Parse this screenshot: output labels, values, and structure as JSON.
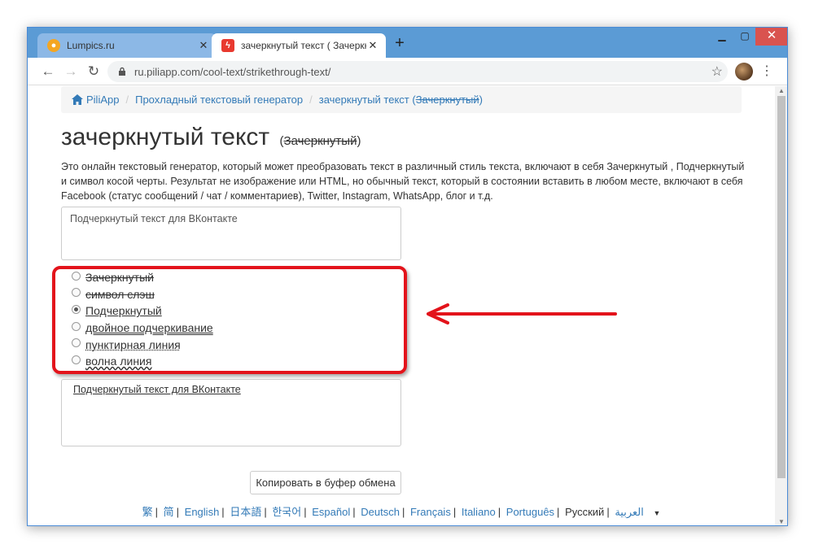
{
  "browser": {
    "tabs": [
      {
        "title": "Lumpics.ru",
        "active": false
      },
      {
        "title": "зачеркнутый текст ( Зачеркнут",
        "active": true
      }
    ],
    "url": "ru.piliapp.com/cool-text/strikethrough-text/"
  },
  "breadcrumb": {
    "home": "PiliApp",
    "item1": "Прохладный текстовый генератор",
    "item2_prefix": "зачеркнутый текст (",
    "item2_strike": "Зачеркнутый",
    "item2_suffix": ")"
  },
  "page": {
    "title": "зачеркнутый текст",
    "title_sub_open": "(",
    "title_sub_strike": "Зачеркнутый",
    "title_sub_close": ")",
    "intro": "Это онлайн текстовый генератор, который может преобразовать текст в различный стиль текста, включают в себя Зачеркнутый , Подчеркнутый и символ косой черты. Результат не изображение или HTML, но обычный текст, который в состоянии вставить в любом месте, включают в себя Facebook (статус сообщений / чат / комментариев), Twitter, Instagram, WhatsApp, блог и т.д."
  },
  "input": {
    "value": "Подчеркнутый текст для ВКонтакте"
  },
  "options": {
    "items": [
      {
        "label": "Зачеркнутый",
        "style": "strike"
      },
      {
        "label": "символ слэш",
        "style": "slash"
      },
      {
        "label": "Подчеркнутый",
        "style": "underline"
      },
      {
        "label": "двойное подчеркивание",
        "style": "double"
      },
      {
        "label": "пунктирная линия",
        "style": "dotted"
      },
      {
        "label": "волна линия",
        "style": "wavy"
      }
    ],
    "selected": "Подчеркнутый"
  },
  "output": {
    "value": "Подчеркнутый текст для ВКонтакте"
  },
  "copy_button": "Копировать в буфер обмена",
  "languages": {
    "items": [
      "繁",
      "简",
      "English",
      "日本語",
      "한국어",
      "Español",
      "Deutsch",
      "Français",
      "Italiano",
      "Português",
      "Русский",
      "العربية"
    ],
    "current": "Русский"
  },
  "colors": {
    "highlight": "#e3131b",
    "link": "#337ab7",
    "titlebar": "#5b9bd5"
  }
}
